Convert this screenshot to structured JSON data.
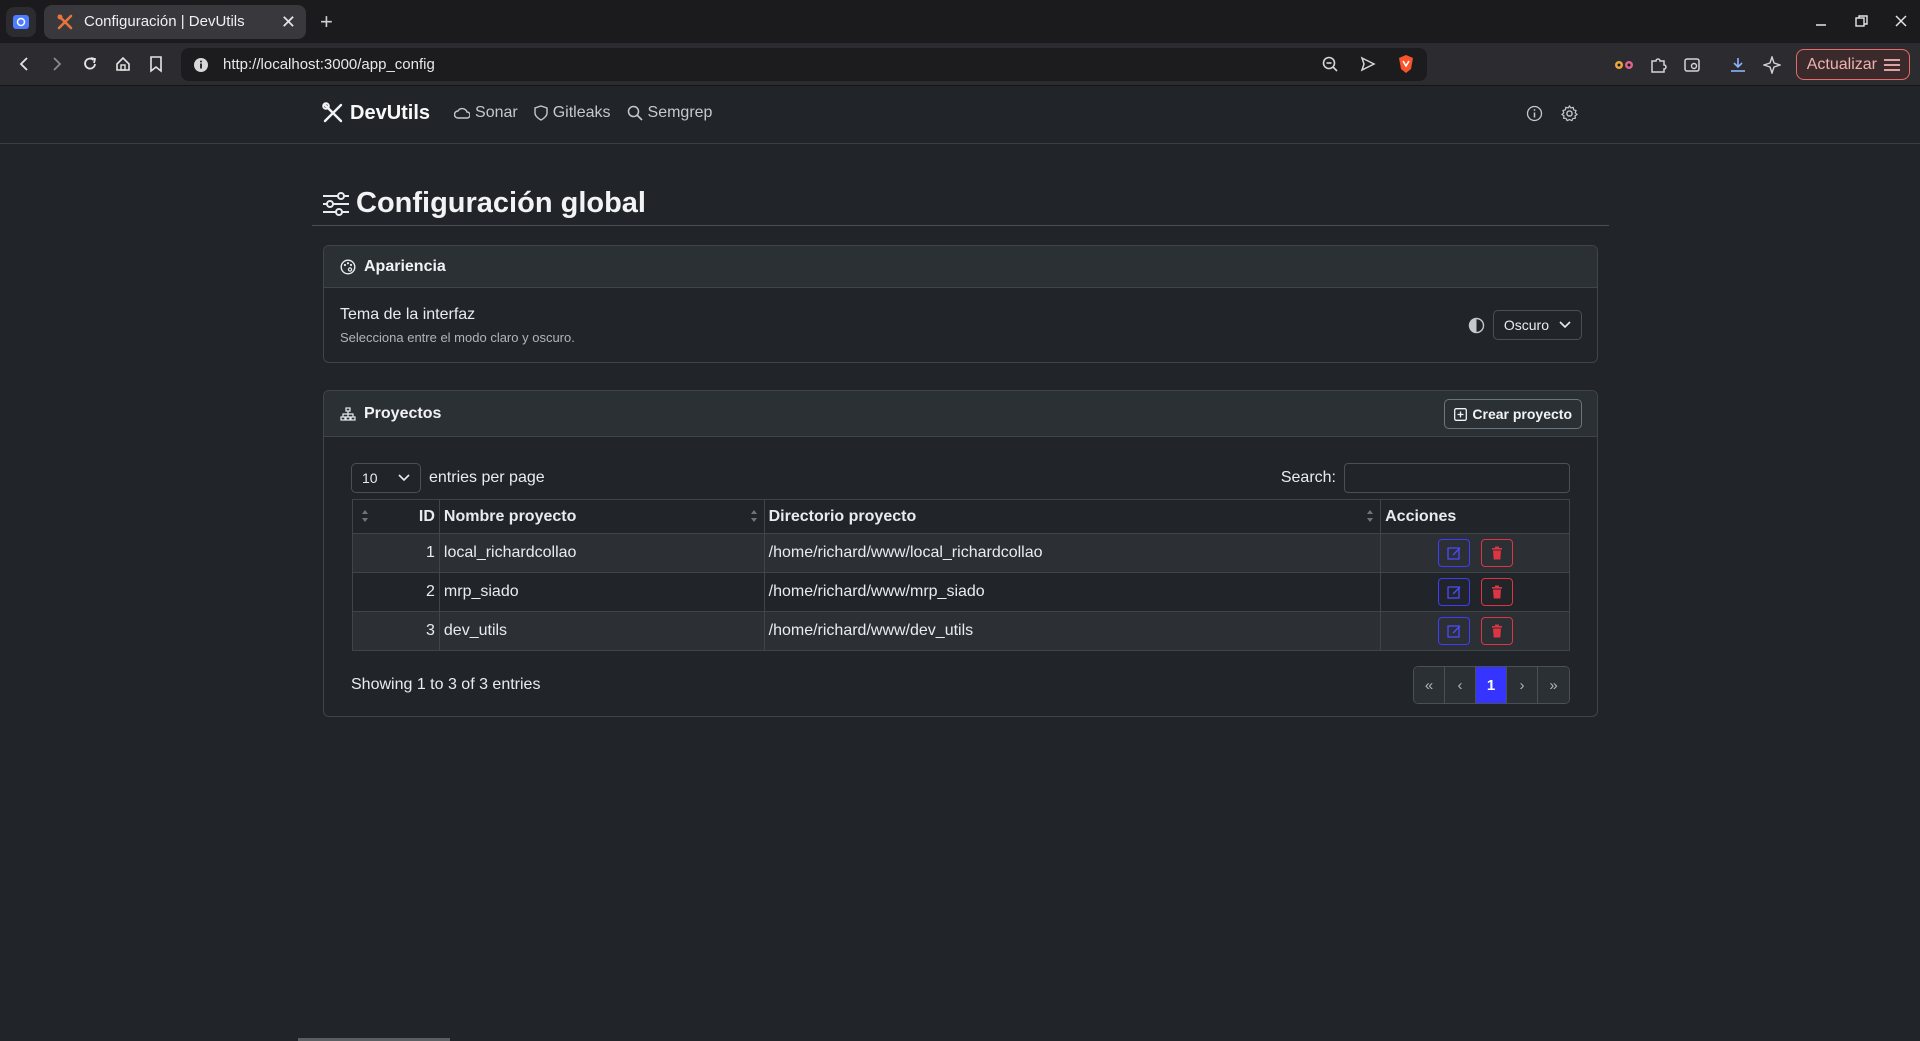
{
  "browser": {
    "tab_title": "Configuración | DevUtils",
    "url": "http://localhost:3000/app_config",
    "update_label": "Actualizar"
  },
  "app": {
    "brand": "DevUtils",
    "nav": [
      {
        "label": "Sonar",
        "icon": "cloud-icon"
      },
      {
        "label": "Gitleaks",
        "icon": "shield-icon"
      },
      {
        "label": "Semgrep",
        "icon": "search-icon"
      }
    ]
  },
  "page": {
    "title": "Configuración global"
  },
  "appearance": {
    "header": "Apariencia",
    "theme_label": "Tema de la interfaz",
    "theme_desc": "Selecciona entre el modo claro y oscuro.",
    "theme_value": "Oscuro"
  },
  "projects": {
    "header": "Proyectos",
    "create_label": "Crear proyecto",
    "entries_value": "10",
    "entries_label": "entries per page",
    "search_label": "Search:",
    "search_value": "",
    "columns": [
      "ID",
      "Nombre proyecto",
      "Directorio proyecto",
      "Acciones"
    ],
    "rows": [
      {
        "id": "1",
        "name": "local_richardcollao",
        "dir": "/home/richard/www/local_richardcollao"
      },
      {
        "id": "2",
        "name": "mrp_siado",
        "dir": "/home/richard/www/mrp_siado"
      },
      {
        "id": "3",
        "name": "dev_utils",
        "dir": "/home/richard/www/dev_utils"
      }
    ],
    "info": "Showing 1 to 3 of 3 entries",
    "pager": [
      "«",
      "‹",
      "1",
      "›",
      "»"
    ]
  },
  "colors": {
    "background": "#212529",
    "primary": "#3535ff",
    "danger": "#dc3545"
  }
}
